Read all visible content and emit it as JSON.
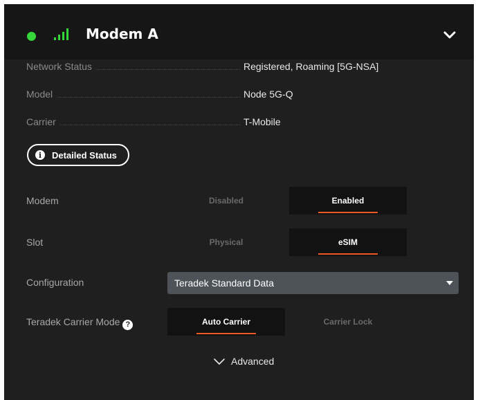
{
  "header": {
    "title": "Modem A",
    "status_color": "#35d63a",
    "status_icon": "status-dot-icon",
    "signal_icon": "signal-bars-icon",
    "collapse_icon": "chevron-down-icon"
  },
  "info": {
    "rows": [
      {
        "label": "Network Status",
        "value": "Registered, Roaming [5G-NSA]"
      },
      {
        "label": "Model",
        "value": "Node 5G-Q"
      },
      {
        "label": "Carrier",
        "value": "T-Mobile"
      }
    ],
    "detailed_status_label": "Detailed Status",
    "detailed_status_icon": "info-icon"
  },
  "fields": {
    "modem": {
      "label": "Modem",
      "options": [
        "Disabled",
        "Enabled"
      ],
      "selected": "Enabled"
    },
    "slot": {
      "label": "Slot",
      "options": [
        "Physical",
        "eSIM"
      ],
      "selected": "eSIM"
    },
    "configuration": {
      "label": "Configuration",
      "value": "Teradek Standard Data"
    },
    "carrier_mode": {
      "label": "Teradek Carrier Mode",
      "help_icon": "help-icon",
      "options": [
        "Auto Carrier",
        "Carrier Lock"
      ],
      "selected": "Auto Carrier"
    }
  },
  "advanced": {
    "label": "Advanced",
    "icon": "chevron-down-icon"
  },
  "colors": {
    "accent": "#ee5a24",
    "panel": "#1f1f1f",
    "header": "#161616",
    "select": "#4e5359"
  }
}
